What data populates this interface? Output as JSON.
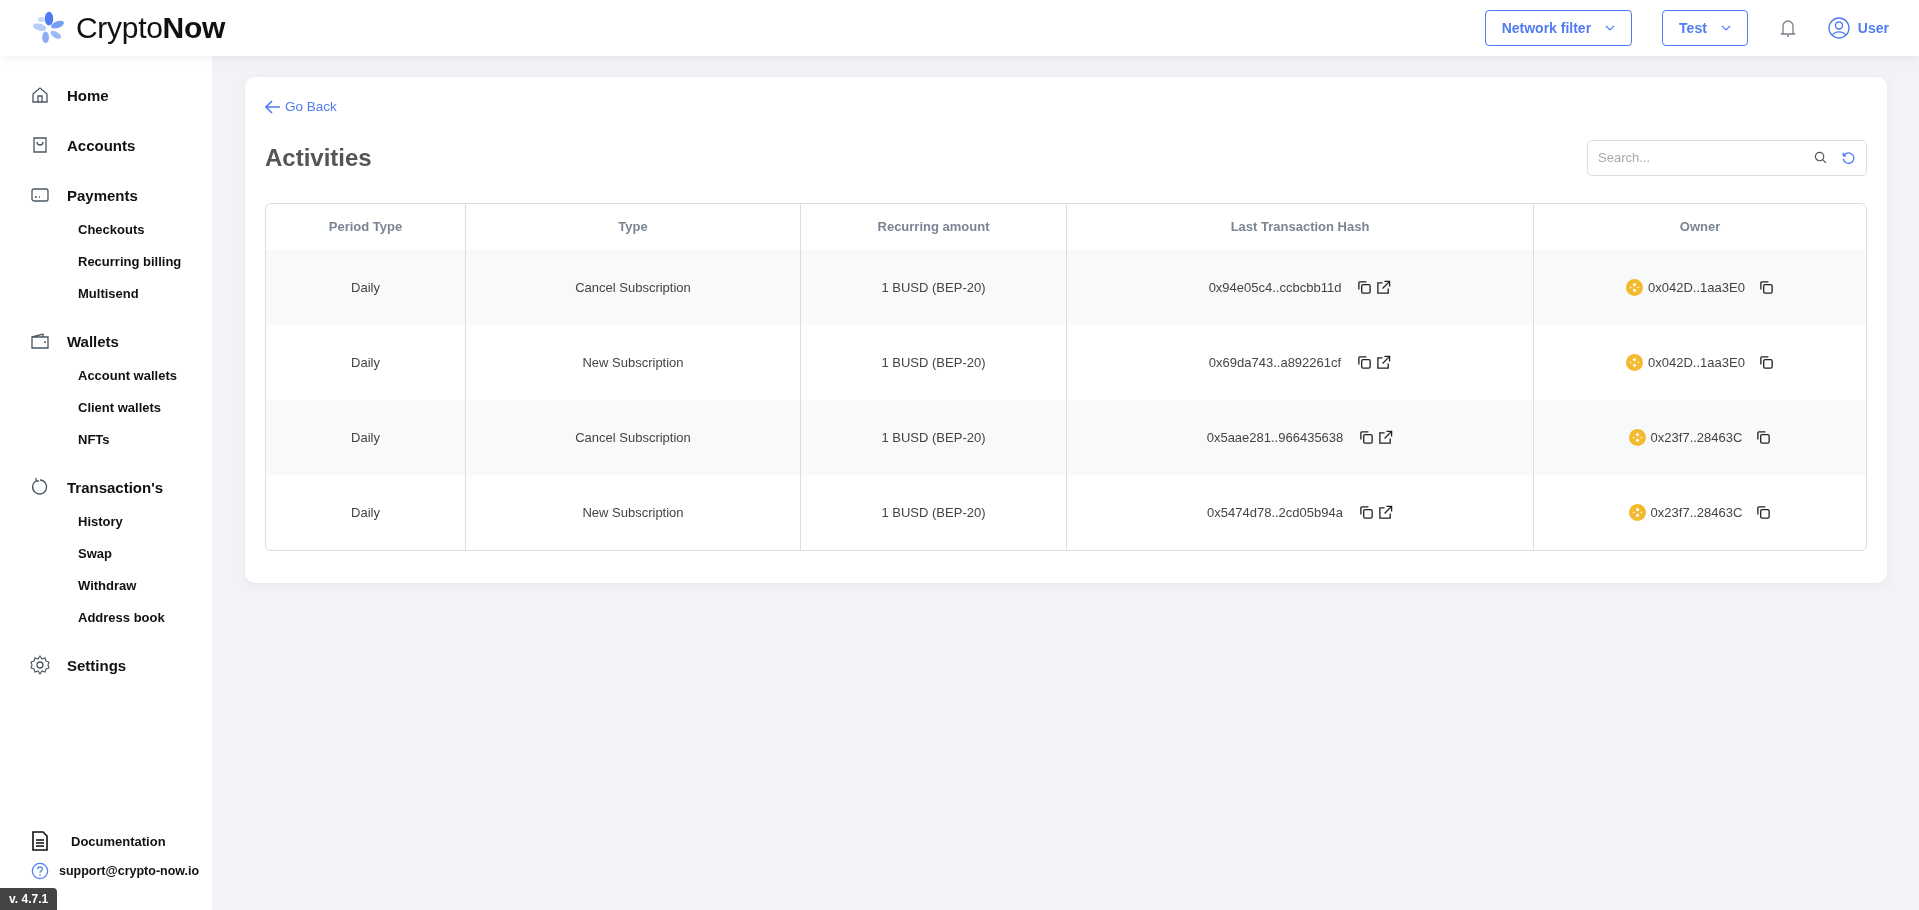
{
  "header": {
    "logo": {
      "light": "Crypto",
      "bold": "Now"
    },
    "network_filter": "Network filter",
    "environment": "Test",
    "user": "User"
  },
  "sidebar": {
    "items": [
      {
        "label": "Home"
      },
      {
        "label": "Accounts"
      },
      {
        "label": "Payments",
        "children": [
          "Checkouts",
          "Recurring billing",
          "Multisend"
        ]
      },
      {
        "label": "Wallets",
        "children": [
          "Account wallets",
          "Client wallets",
          "NFTs"
        ]
      },
      {
        "label": "Transaction's",
        "children": [
          "History",
          "Swap",
          "Withdraw",
          "Address book"
        ]
      },
      {
        "label": "Settings"
      }
    ],
    "documentation": "Documentation",
    "support": "support@crypto-now.io",
    "version": "v. 4.7.1"
  },
  "page": {
    "back": "Go Back",
    "title": "Activities",
    "search": {
      "placeholder": "Search..."
    }
  },
  "table": {
    "columns": [
      "Period Type",
      "Type",
      "Recurring amount",
      "Last Transaction Hash",
      "Owner"
    ],
    "rows": [
      {
        "period": "Daily",
        "type": "Cancel Subscription",
        "amount": "1 BUSD (BEP-20)",
        "hash": "0x94e05c4..ccbcbb11d",
        "owner": "0x042D..1aa3E0"
      },
      {
        "period": "Daily",
        "type": "New Subscription",
        "amount": "1 BUSD (BEP-20)",
        "hash": "0x69da743..a892261cf",
        "owner": "0x042D..1aa3E0"
      },
      {
        "period": "Daily",
        "type": "Cancel Subscription",
        "amount": "1 BUSD (BEP-20)",
        "hash": "0x5aae281..966435638",
        "owner": "0x23f7..28463C"
      },
      {
        "period": "Daily",
        "type": "New Subscription",
        "amount": "1 BUSD (BEP-20)",
        "hash": "0x5474d78..2cd05b94a",
        "owner": "0x23f7..28463C"
      }
    ]
  }
}
